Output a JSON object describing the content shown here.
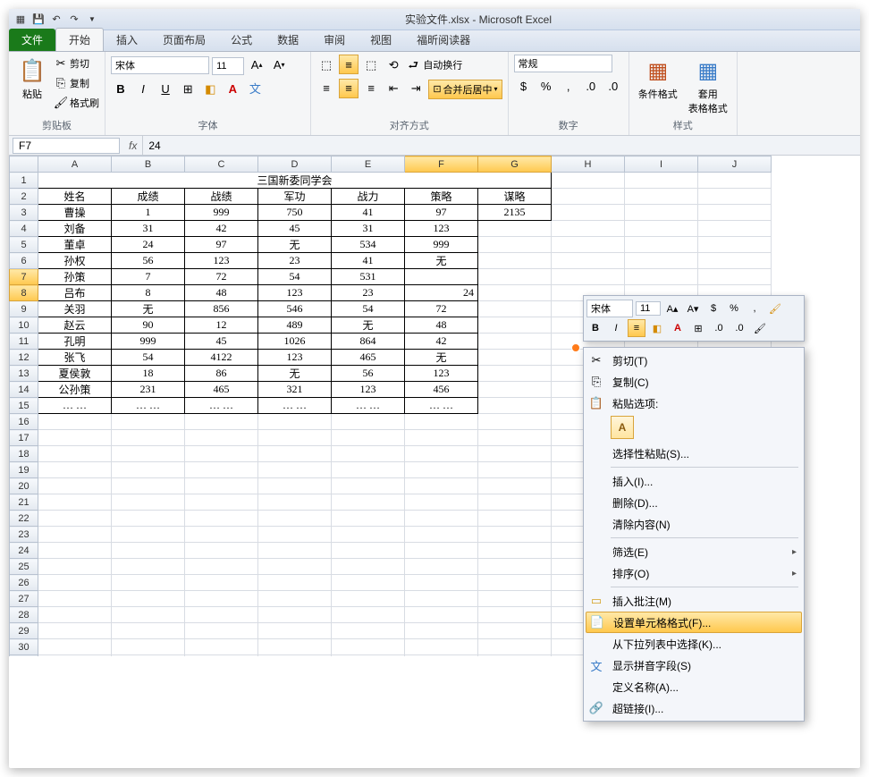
{
  "title": "实验文件.xlsx - Microsoft Excel",
  "tabs": {
    "file": "文件",
    "home": "开始",
    "insert": "插入",
    "layout": "页面布局",
    "formulas": "公式",
    "data": "数据",
    "review": "审阅",
    "view": "视图",
    "foxit": "福昕阅读器"
  },
  "ribbon": {
    "clipboard": {
      "label": "剪贴板",
      "paste": "粘贴",
      "cut": "剪切",
      "copy": "复制",
      "painter": "格式刷"
    },
    "font": {
      "label": "字体",
      "name": "宋体",
      "size": "11"
    },
    "align": {
      "label": "对齐方式",
      "wrap": "自动换行",
      "merge": "合并后居中"
    },
    "number": {
      "label": "数字",
      "format": "常规"
    },
    "styles": {
      "label": "样式",
      "cond": "条件格式",
      "table": "套用\n表格格式"
    }
  },
  "formula_bar": {
    "cell": "F7",
    "value": "24"
  },
  "columns": [
    "A",
    "B",
    "C",
    "D",
    "E",
    "F",
    "G",
    "H",
    "I",
    "J"
  ],
  "sheet": {
    "title": "三国新委同学会",
    "headers": [
      "姓名",
      "成绩",
      "战绩",
      "军功",
      "战力",
      "策略",
      "谋略"
    ],
    "rows": [
      [
        "曹操",
        "1",
        "999",
        "750",
        "41",
        "97",
        "2135"
      ],
      [
        "刘备",
        "31",
        "42",
        "45",
        "31",
        "123",
        ""
      ],
      [
        "董卓",
        "24",
        "97",
        "无",
        "534",
        "999",
        ""
      ],
      [
        "孙权",
        "56",
        "123",
        "23",
        "41",
        "无",
        ""
      ],
      [
        "孙策",
        "7",
        "72",
        "54",
        "531",
        "",
        ""
      ],
      [
        "吕布",
        "8",
        "48",
        "123",
        "23",
        "24",
        ""
      ],
      [
        "关羽",
        "无",
        "856",
        "546",
        "54",
        "72",
        ""
      ],
      [
        "赵云",
        "90",
        "12",
        "489",
        "无",
        "48",
        ""
      ],
      [
        "孔明",
        "999",
        "45",
        "1026",
        "864",
        "42",
        ""
      ],
      [
        "张飞",
        "54",
        "4122",
        "123",
        "465",
        "无",
        ""
      ],
      [
        "夏侯敦",
        "18",
        "86",
        "无",
        "56",
        "123",
        ""
      ],
      [
        "公孙策",
        "231",
        "465",
        "321",
        "123",
        "456",
        ""
      ],
      [
        "… …",
        "… …",
        "… …",
        "… …",
        "… …",
        "… …",
        ""
      ]
    ]
  },
  "mini": {
    "font": "宋体",
    "size": "11"
  },
  "ctx": {
    "cut": "剪切(T)",
    "copy": "复制(C)",
    "paste_opts": "粘贴选项:",
    "paste_special": "选择性粘贴(S)...",
    "insert": "插入(I)...",
    "delete": "删除(D)...",
    "clear": "清除内容(N)",
    "filter": "筛选(E)",
    "sort": "排序(O)",
    "comment": "插入批注(M)",
    "format": "设置单元格格式(F)...",
    "dropdown": "从下拉列表中选择(K)...",
    "phonetic": "显示拼音字段(S)",
    "name": "定义名称(A)...",
    "link": "超链接(I)..."
  }
}
